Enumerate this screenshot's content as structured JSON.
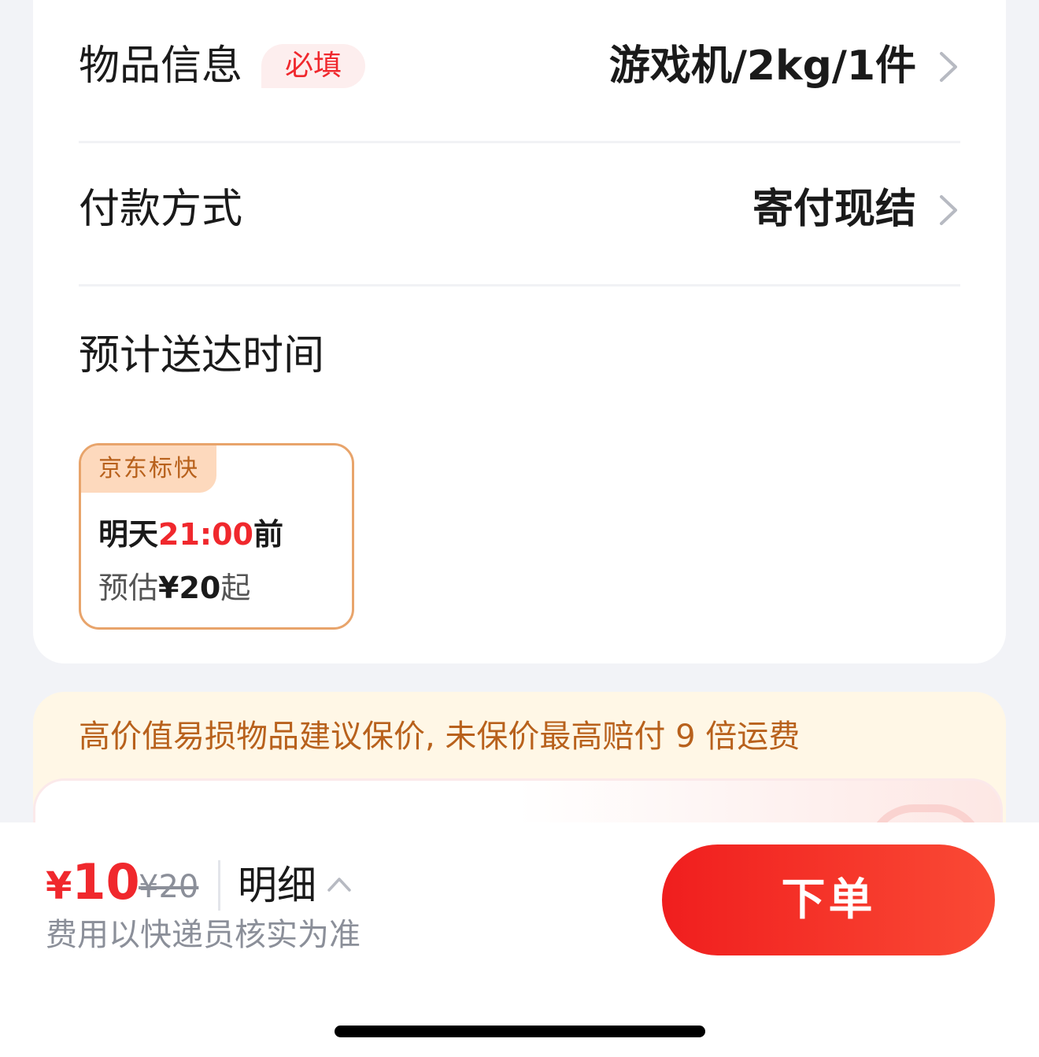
{
  "item_info": {
    "label": "物品信息",
    "required_badge": "必填",
    "value": "游戏机/2kg/1件"
  },
  "payment": {
    "label": "付款方式",
    "value": "寄付现结"
  },
  "eta": {
    "title": "预计送达时间",
    "option": {
      "tag": "京东标快",
      "time_prefix": "明天",
      "time_highlight": "21:00",
      "time_suffix": "前",
      "price_prefix": "预估",
      "price_value": "¥20",
      "price_suffix": "起"
    }
  },
  "insurance": {
    "notice": "高价值易损物品建议保价, 未保价最高赔付 9 倍运费"
  },
  "footer": {
    "currency": "¥",
    "price_current": "10",
    "price_original": "¥20",
    "detail_label": "明细",
    "fee_note": "费用以快递员核实为准",
    "order_button": "下单"
  },
  "colors": {
    "accent_red": "#f0282d",
    "tag_orange": "#b8611c",
    "muted_gray": "#8b8f99"
  }
}
